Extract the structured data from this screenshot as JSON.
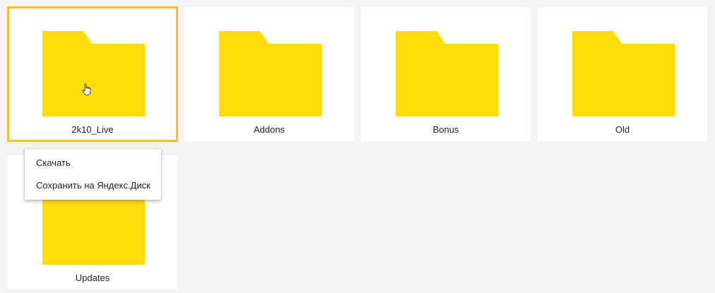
{
  "colors": {
    "page_background": "#f4f4f4",
    "tile_background": "#ffffff",
    "folder": "#ffdd0b",
    "selection_border": "#f6c218",
    "text": "#222222"
  },
  "folders": [
    {
      "name": "2k10_Live",
      "icon": "folder-icon",
      "selected": true
    },
    {
      "name": "Addons",
      "icon": "folder-icon",
      "selected": false
    },
    {
      "name": "Bonus",
      "icon": "folder-icon",
      "selected": false
    },
    {
      "name": "Old",
      "icon": "folder-icon",
      "selected": false
    },
    {
      "name": "Updates",
      "icon": "folder-icon",
      "selected": false
    }
  ],
  "context_menu": {
    "items": [
      {
        "label": "Скачать"
      },
      {
        "label": "Сохранить на Яндекс.Диск"
      }
    ]
  },
  "cursor": {
    "icon": "hand-pointer-icon"
  }
}
